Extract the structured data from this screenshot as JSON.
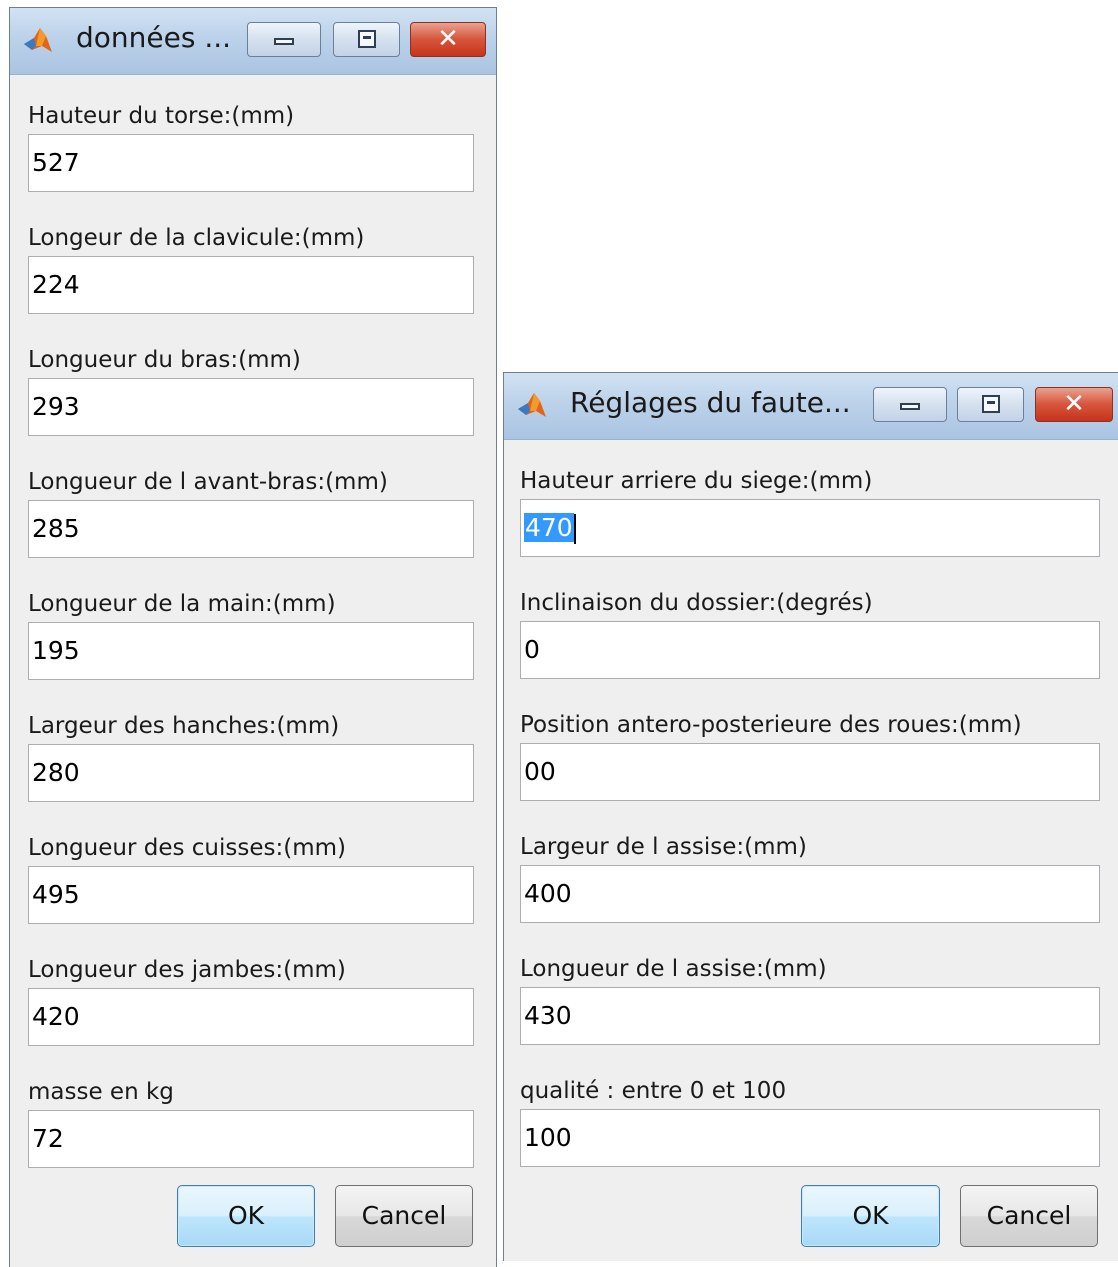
{
  "dialogs": [
    {
      "title": "données ...",
      "fields": [
        {
          "label": "Hauteur du torse:(mm)",
          "value": "527"
        },
        {
          "label": "Longeur de la clavicule:(mm)",
          "value": "224"
        },
        {
          "label": "Longueur du bras:(mm)",
          "value": "293"
        },
        {
          "label": "Longueur de l avant-bras:(mm)",
          "value": "285"
        },
        {
          "label": "Longueur de la main:(mm)",
          "value": "195"
        },
        {
          "label": "Largeur des hanches:(mm)",
          "value": "280"
        },
        {
          "label": "Longueur des cuisses:(mm)",
          "value": "495"
        },
        {
          "label": "Longueur des jambes:(mm)",
          "value": "420"
        },
        {
          "label": "masse en kg",
          "value": "72"
        }
      ],
      "ok_label": "OK",
      "cancel_label": "Cancel"
    },
    {
      "title": "Réglages du faute...",
      "fields": [
        {
          "label": "Hauteur arriere du siege:(mm)",
          "value": "470"
        },
        {
          "label": "Inclinaison du dossier:(degrés)",
          "value": "0"
        },
        {
          "label": "Position antero-posterieure des roues:(mm)",
          "value": "00"
        },
        {
          "label": "Largeur de l assise:(mm)",
          "value": "400"
        },
        {
          "label": "Longueur de l assise:(mm)",
          "value": "430"
        },
        {
          "label": "qualité : entre 0 et 100",
          "value": "100"
        }
      ],
      "ok_label": "OK",
      "cancel_label": "Cancel"
    }
  ],
  "icons": {
    "app": "matlab-logo-icon",
    "minimize": "minimize-icon",
    "maximize": "maximize-icon",
    "close": "close-icon"
  },
  "colors": {
    "selection": "#3399ff",
    "close_button": "#c7331b",
    "default_button": "#bee6fd"
  }
}
